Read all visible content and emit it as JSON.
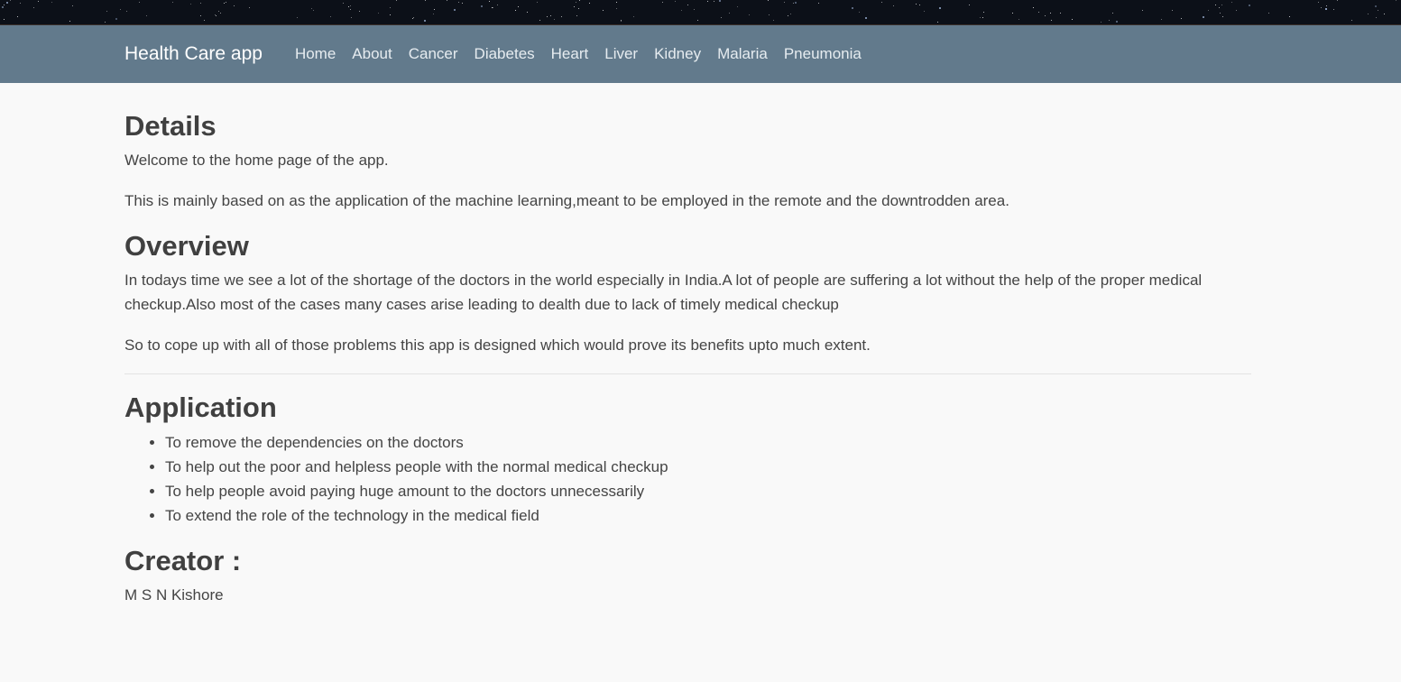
{
  "navbar": {
    "brand": "Health Care app",
    "items": [
      "Home",
      "About",
      "Cancer",
      "Diabetes",
      "Heart",
      "Liver",
      "Kidney",
      "Malaria",
      "Pneumonia"
    ]
  },
  "sections": {
    "details": {
      "heading": "Details",
      "paragraphs": [
        "Welcome to the home page of the app.",
        "This is mainly based on as the application of the machine learning,meant to be employed in the remote and the downtrodden area."
      ]
    },
    "overview": {
      "heading": "Overview",
      "paragraphs": [
        "In todays time we see a lot of the shortage of the doctors in the world especially in India.A lot of people are suffering a lot without the help of the proper medical checkup.Also most of the cases many cases arise leading to dealth due to lack of timely medical checkup",
        "So to cope up with all of those problems this app is designed which would prove its benefits upto much extent."
      ]
    },
    "application": {
      "heading": "Application",
      "items": [
        "To remove the dependencies on the doctors",
        "To help out the poor and helpless people with the normal medical checkup",
        "To help people avoid paying huge amount to the doctors unnecessarily",
        "To extend the role of the technology in the medical field"
      ]
    },
    "creator": {
      "heading": "Creator :",
      "name": "M S N Kishore"
    }
  },
  "colors": {
    "navbar_bg": "#627a8c",
    "page_bg": "#f9f9f9",
    "text": "#444444",
    "top_strip": "#0c1018"
  }
}
